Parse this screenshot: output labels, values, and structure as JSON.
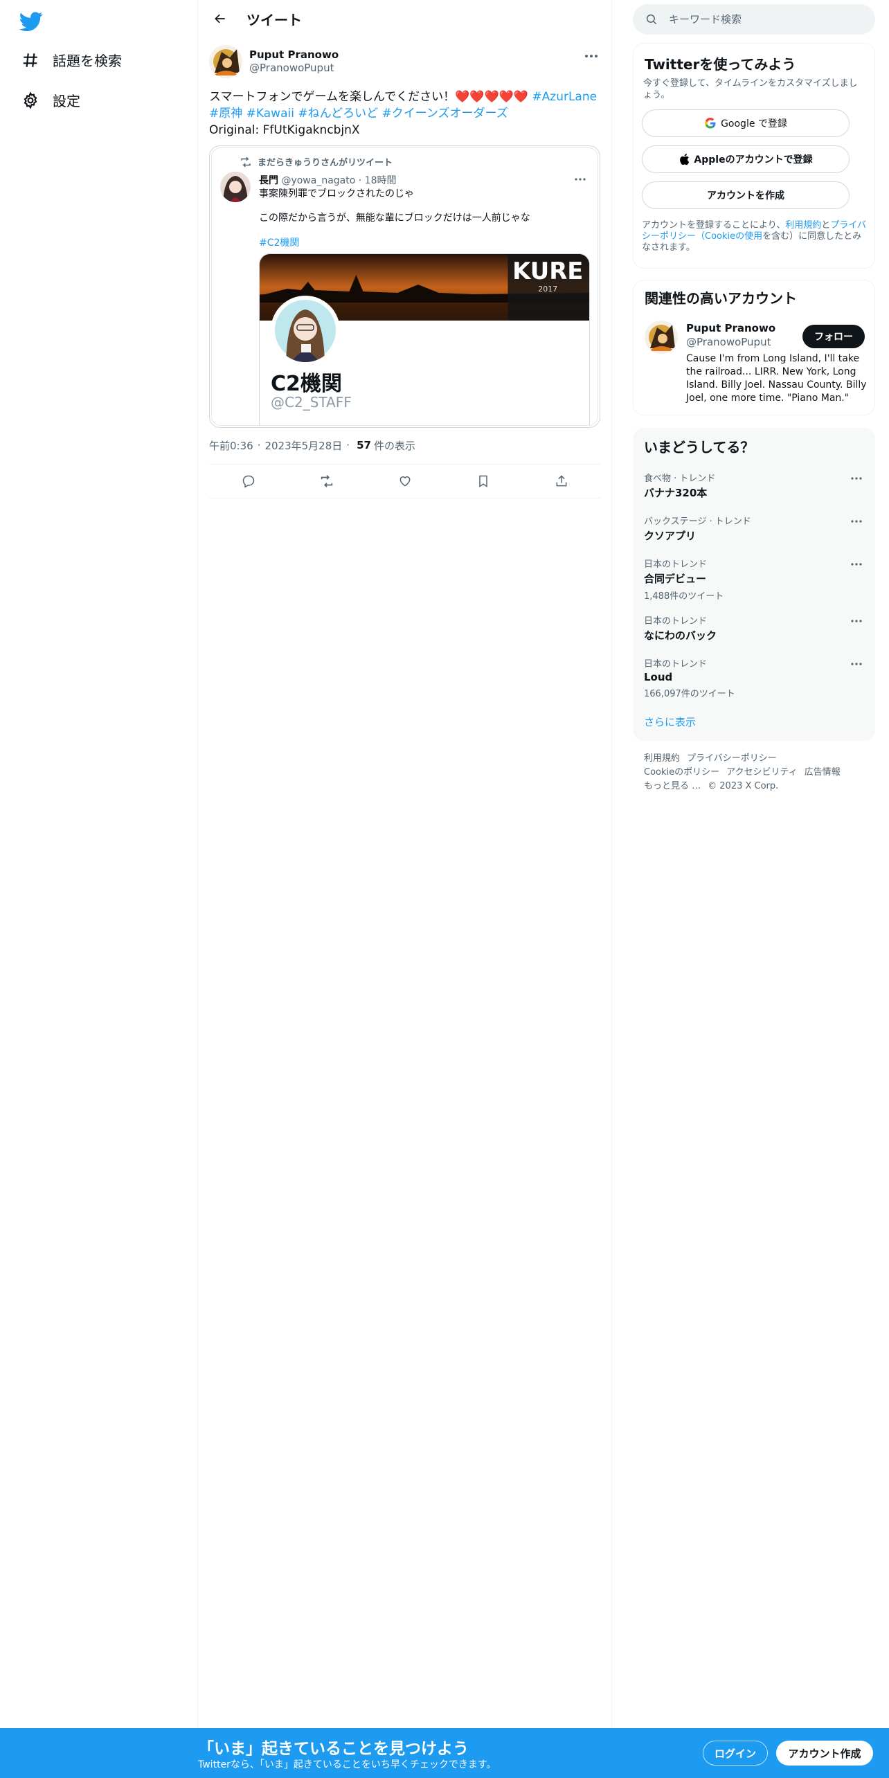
{
  "colors": {
    "accent": "#1d9bf0",
    "text": "#0f1419",
    "muted": "#536471",
    "heart": "#e0245e"
  },
  "nav": {
    "logo_icon": "twitter-bird-icon",
    "items": [
      {
        "label": "話題を検索",
        "icon": "hashtag-icon"
      },
      {
        "label": "設定",
        "icon": "gear-icon"
      }
    ]
  },
  "header": {
    "title": "ツイート"
  },
  "tweet": {
    "author_name": "Puput Pranowo",
    "author_handle": "@PranowoPuput",
    "text_main": "スマートフォンでゲームを楽しんでください！",
    "hearts": "❤️❤️❤️❤️❤️",
    "hashtags": [
      "#AzurLane",
      "#原神",
      "#Kawaii",
      "#ねんどろいど",
      "#クイーンズオーダーズ"
    ],
    "original_line": "Original: FfUtKigakncbjnX",
    "embed": {
      "retweet_label": "まだらきゅうりさんがリツイート",
      "name": "長門",
      "handle": "@yowa_nagato",
      "time": "· 18時間",
      "text1": "事案陳列罪でブロックされたのじゃ",
      "text2": "この際だから言うが、無能な輩にブロックだけは一人前じゃな",
      "hashtag": "#C2機関",
      "card": {
        "banner_text": "KURE",
        "banner_year": "2017",
        "name": "C2機関",
        "handle": "@C2_STAFF"
      }
    },
    "time": "午前0:36",
    "date": "2023年5月28日",
    "views_count": "57",
    "views_label": "件の表示"
  },
  "search": {
    "placeholder": "キーワード検索"
  },
  "signup": {
    "title": "Twitterを使ってみよう",
    "subtitle": "今すぐ登録して、タイムラインをカスタマイズしましょう。",
    "google_label": "Google で登録",
    "apple_label": "Appleのアカウントで登録",
    "create_label": "アカウントを作成",
    "terms_prefix": "アカウントを登録することにより、",
    "terms_link1": "利用規約",
    "terms_and": "と",
    "terms_link2": "プライバシーポリシー（Cookieの使用",
    "terms_suffix": "を含む）に同意したとみなされます。"
  },
  "related": {
    "title": "関連性の高いアカウント",
    "name": "Puput Pranowo",
    "handle": "@PranowoPuput",
    "follow_label": "フォロー",
    "bio": "Cause I'm from Long Island, I'll take the railroad... LIRR. New York, Long Island. Billy Joel. Nassau County. Billy Joel, one more time. \"Piano Man.\""
  },
  "trends": {
    "title": "いまどうしてる？",
    "items": [
      {
        "category": "食べ物 · トレンド",
        "name": "バナナ320本",
        "count": ""
      },
      {
        "category": "バックステージ · トレンド",
        "name": "クソアプリ",
        "count": ""
      },
      {
        "category": "日本のトレンド",
        "name": "合同デビュー",
        "count": "1,488件のツイート"
      },
      {
        "category": "日本のトレンド",
        "name": "なにわのバック",
        "count": ""
      },
      {
        "category": "日本のトレンド",
        "name": "Loud",
        "count": "166,097件のツイート"
      }
    ],
    "show_more": "さらに表示"
  },
  "footer": {
    "links": [
      "利用規約",
      "プライバシーポリシー",
      "Cookieのポリシー",
      "アクセシビリティ",
      "広告情報",
      "もっと見る …"
    ],
    "copyright": "© 2023 X Corp."
  },
  "bottom_bar": {
    "title": "「いま」起きていることを見つけよう",
    "subtitle": "Twitterなら、「いま」起きていることをいち早くチェックできます。",
    "login_label": "ログイン",
    "signup_label": "アカウント作成"
  }
}
